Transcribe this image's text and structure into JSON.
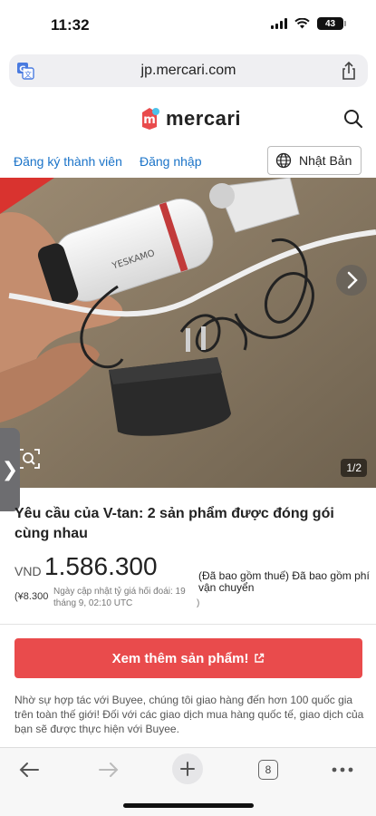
{
  "status_bar": {
    "time": "11:32",
    "battery": "43"
  },
  "browser": {
    "url": "jp.mercari.com",
    "tab_count": "8"
  },
  "header": {
    "logo_text": "mercari"
  },
  "auth": {
    "register": "Đăng ký thành viên",
    "login": "Đăng nhập",
    "language": "Nhật Bản"
  },
  "gallery": {
    "page_indicator": "1/2",
    "side_tab_glyph": "❯",
    "camera_brand": "YESKAMO"
  },
  "product": {
    "title": "Yêu cầu của V-tan: 2 sản phẩm được đóng gói cùng nhau",
    "currency": "VND",
    "price": "1.586.300",
    "tax_note": "(Đã bao gồm thuế) Đã bao gồm phí vận chuyển",
    "yen_price": "(¥8.300",
    "rate_note": "Ngày cập nhật tỷ giá hối đoái: 19 tháng 9, 02:10 UTC",
    "rate_note_close": ")"
  },
  "cta": {
    "label": "Xem thêm sản phẩm!"
  },
  "buyee_note": "Nhờ sự hợp tác với Buyee, chúng tôi giao hàng đến hơn 100 quốc gia trên toàn thế giới! Đối với các giao dịch mua hàng quốc tế, giao dịch của bạn sẽ được thực hiện với Buyee.",
  "colors": {
    "accent_red": "#e94b4c",
    "link_blue": "#1a73c8"
  }
}
